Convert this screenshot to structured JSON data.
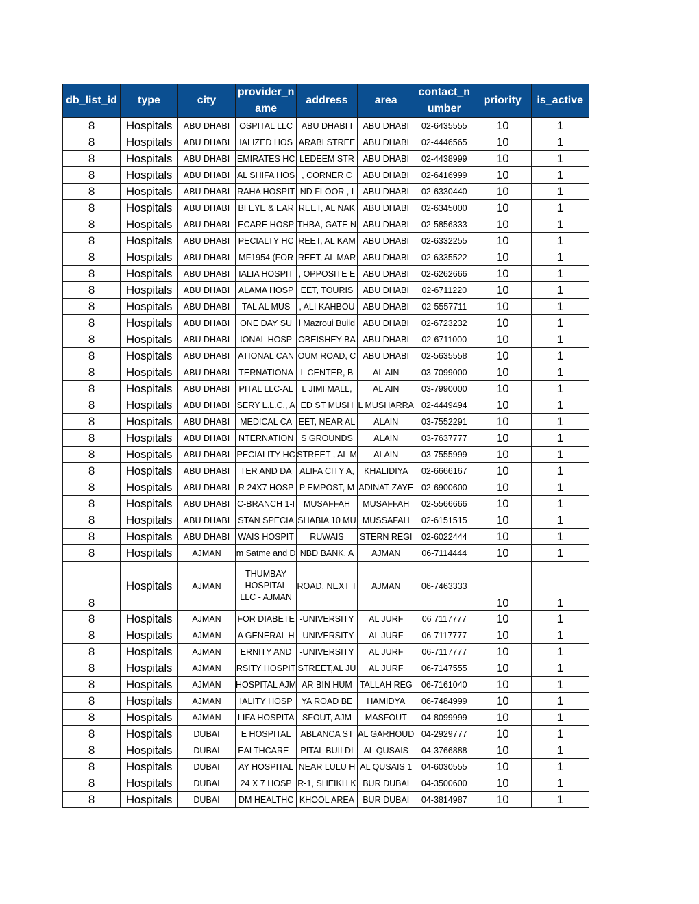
{
  "headers": [
    "db_list_id",
    "type",
    "city",
    "provider_name",
    "address",
    "area",
    "contact_number",
    "priority",
    "is_active"
  ],
  "header_color": "#0b4f91",
  "rows": [
    {
      "db_list_id": "8",
      "type": "Hospitals",
      "city": "ABU DHABI",
      "provider_name": "OSPITAL LLC",
      "address": "ABU DHABI I",
      "area": "ABU DHABI",
      "contact_number": "02-6435555",
      "priority": "10",
      "is_active": "1"
    },
    {
      "db_list_id": "8",
      "type": "Hospitals",
      "city": "ABU DHABI",
      "provider_name": "IALIZED HOS",
      "address": "ARABI STREE",
      "area": "ABU DHABI",
      "contact_number": "02-4446565",
      "priority": "10",
      "is_active": "1"
    },
    {
      "db_list_id": "8",
      "type": "Hospitals",
      "city": "ABU DHABI",
      "provider_name": "EMIRATES HC",
      "address": "LEDEEM STR",
      "area": "ABU DHABI",
      "contact_number": "02-4438999",
      "priority": "10",
      "is_active": "1"
    },
    {
      "db_list_id": "8",
      "type": "Hospitals",
      "city": "ABU DHABI",
      "provider_name": "AL SHIFA HOS",
      "address": ", CORNER C",
      "area": "ABU DHABI",
      "contact_number": "02-6416999",
      "priority": "10",
      "is_active": "1"
    },
    {
      "db_list_id": "8",
      "type": "Hospitals",
      "city": "ABU DHABI",
      "provider_name": "RAHA HOSPIT",
      "address": "ND FLOOR , I",
      "area": "ABU DHABI",
      "contact_number": "02-6330440",
      "priority": "10",
      "is_active": "1"
    },
    {
      "db_list_id": "8",
      "type": "Hospitals",
      "city": "ABU DHABI",
      "provider_name": "BI EYE & EAR",
      "address": "REET, AL NAK",
      "area": "ABU DHABI",
      "contact_number": "02-6345000",
      "priority": "10",
      "is_active": "1"
    },
    {
      "db_list_id": "8",
      "type": "Hospitals",
      "city": "ABU DHABI",
      "provider_name": "ECARE HOSP",
      "address": "THBA, GATE N",
      "area": "ABU DHABI",
      "contact_number": "02-5856333",
      "priority": "10",
      "is_active": "1"
    },
    {
      "db_list_id": "8",
      "type": "Hospitals",
      "city": "ABU DHABI",
      "provider_name": "PECIALTY HC",
      "address": "REET, AL KAM",
      "area": "ABU DHABI",
      "contact_number": "02-6332255",
      "priority": "10",
      "is_active": "1"
    },
    {
      "db_list_id": "8",
      "type": "Hospitals",
      "city": "ABU DHABI",
      "provider_name": "MF1954 (FOR",
      "address": "REET, AL MAR",
      "area": "ABU DHABI",
      "contact_number": "02-6335522",
      "priority": "10",
      "is_active": "1"
    },
    {
      "db_list_id": "8",
      "type": "Hospitals",
      "city": "ABU DHABI",
      "provider_name": "IALIA HOSPIT",
      "address": ", OPPOSITE E",
      "area": "ABU DHABI",
      "contact_number": "02-6262666",
      "priority": "10",
      "is_active": "1"
    },
    {
      "db_list_id": "8",
      "type": "Hospitals",
      "city": "ABU DHABI",
      "provider_name": "ALAMA HOSP",
      "address": "EET, TOURIS",
      "area": "ABU DHABI",
      "contact_number": "02-6711220",
      "priority": "10",
      "is_active": "1"
    },
    {
      "db_list_id": "8",
      "type": "Hospitals",
      "city": "ABU DHABI",
      "provider_name": "TAL AL MUS",
      "address": ", ALI KAHBOU",
      "area": "ABU DHABI",
      "contact_number": "02-5557711",
      "priority": "10",
      "is_active": "1"
    },
    {
      "db_list_id": "8",
      "type": "Hospitals",
      "city": "ABU DHABI",
      "provider_name": "ONE DAY SU",
      "address": "l Mazroui Build",
      "area": "ABU DHABI",
      "contact_number": "02-6723232",
      "priority": "10",
      "is_active": "1"
    },
    {
      "db_list_id": "8",
      "type": "Hospitals",
      "city": "ABU DHABI",
      "provider_name": "IONAL HOSP",
      "address": "OBEISHEY BA",
      "area": "ABU DHABI",
      "contact_number": "02-6711000",
      "priority": "10",
      "is_active": "1"
    },
    {
      "db_list_id": "8",
      "type": "Hospitals",
      "city": "ABU DHABI",
      "provider_name": "ATIONAL CAN",
      "address": "OUM ROAD, C",
      "area": "ABU DHABI",
      "contact_number": "02-5635558",
      "priority": "10",
      "is_active": "1"
    },
    {
      "db_list_id": "8",
      "type": "Hospitals",
      "city": "ABU DHABI",
      "provider_name": "TERNATIONA",
      "address": "L CENTER, B",
      "area": "AL AIN",
      "contact_number": "03-7099000",
      "priority": "10",
      "is_active": "1"
    },
    {
      "db_list_id": "8",
      "type": "Hospitals",
      "city": "ABU DHABI",
      "provider_name": "PITAL LLC-AL",
      "address": "L JIMI MALL,",
      "area": "AL AIN",
      "contact_number": "03-7990000",
      "priority": "10",
      "is_active": "1"
    },
    {
      "db_list_id": "8",
      "type": "Hospitals",
      "city": "ABU DHABI",
      "provider_name": "SERY L.L.C., A",
      "address": "ED ST MUSH",
      "area": "L MUSHARRA",
      "contact_number": "02-4449494",
      "priority": "10",
      "is_active": "1"
    },
    {
      "db_list_id": "8",
      "type": "Hospitals",
      "city": "ABU DHABI",
      "provider_name": "MEDICAL CA",
      "address": "EET, NEAR AL",
      "area": "ALAIN",
      "contact_number": "03-7552291",
      "priority": "10",
      "is_active": "1"
    },
    {
      "db_list_id": "8",
      "type": "Hospitals",
      "city": "ABU DHABI",
      "provider_name": "NTERNATION",
      "address": "S GROUNDS",
      "area": "ALAIN",
      "contact_number": "03-7637777",
      "priority": "10",
      "is_active": "1"
    },
    {
      "db_list_id": "8",
      "type": "Hospitals",
      "city": "ABU DHABI",
      "provider_name": "PECIALITY HC",
      "address": "STREET , AL M",
      "area": "ALAIN",
      "contact_number": "03-7555999",
      "priority": "10",
      "is_active": "1"
    },
    {
      "db_list_id": "8",
      "type": "Hospitals",
      "city": "ABU DHABI",
      "provider_name": "TER AND DA",
      "address": "ALIFA CITY A,",
      "area": "KHALIDIYA",
      "contact_number": "02-6666167",
      "priority": "10",
      "is_active": "1"
    },
    {
      "db_list_id": "8",
      "type": "Hospitals",
      "city": "ABU DHABI",
      "provider_name": "R 24X7 HOSP",
      "address": "P EMPOST, M",
      "area": "ADINAT ZAYE",
      "contact_number": "02-6900600",
      "priority": "10",
      "is_active": "1"
    },
    {
      "db_list_id": "8",
      "type": "Hospitals",
      "city": "ABU DHABI",
      "provider_name": "C-BRANCH 1-I",
      "address": "MUSAFFAH",
      "area": "MUSAFFAH",
      "contact_number": "02-5566666",
      "priority": "10",
      "is_active": "1"
    },
    {
      "db_list_id": "8",
      "type": "Hospitals",
      "city": "ABU DHABI",
      "provider_name": "STAN SPECIA",
      "address": "SHABIA 10 MU",
      "area": "MUSSAFAH",
      "contact_number": "02-6151515",
      "priority": "10",
      "is_active": "1"
    },
    {
      "db_list_id": "8",
      "type": "Hospitals",
      "city": "ABU DHABI",
      "provider_name": "WAIS HOSPIT",
      "address": "RUWAIS",
      "area": "STERN REGI",
      "contact_number": "02-6022444",
      "priority": "10",
      "is_active": "1"
    },
    {
      "db_list_id": "8",
      "type": "Hospitals",
      "city": "AJMAN",
      "provider_name": "m Satme and D",
      "address": "NBD BANK, A",
      "area": "AJMAN",
      "contact_number": "06-7114444",
      "priority": "10",
      "is_active": "1"
    },
    {
      "db_list_id": "8",
      "type": "Hospitals",
      "city": "AJMAN",
      "provider_name": "THUMBAY HOSPITAL LLC - AJMAN",
      "address": "ROAD, NEXT T",
      "area": "AJMAN",
      "contact_number": "06-7463333",
      "priority": "10",
      "is_active": "1",
      "tall": true
    },
    {
      "db_list_id": "8",
      "type": "Hospitals",
      "city": "AJMAN",
      "provider_name": "FOR DIABETE",
      "address": "-UNIVERSITY",
      "area": "AL JURF",
      "contact_number": "06 7117777",
      "priority": "10",
      "is_active": "1"
    },
    {
      "db_list_id": "8",
      "type": "Hospitals",
      "city": "AJMAN",
      "provider_name": "A GENERAL H",
      "address": "-UNIVERSITY",
      "area": "AL JURF",
      "contact_number": "06-7117777",
      "priority": "10",
      "is_active": "1"
    },
    {
      "db_list_id": "8",
      "type": "Hospitals",
      "city": "AJMAN",
      "provider_name": "ERNITY AND",
      "address": "-UNIVERSITY",
      "area": "AL JURF",
      "contact_number": "06-7117777",
      "priority": "10",
      "is_active": "1"
    },
    {
      "db_list_id": "8",
      "type": "Hospitals",
      "city": "AJMAN",
      "provider_name": "RSITY HOSPIT",
      "address": "STREET,AL JU",
      "area": "AL JURF",
      "contact_number": "06-7147555",
      "priority": "10",
      "is_active": "1"
    },
    {
      "db_list_id": "8",
      "type": "Hospitals",
      "city": "AJMAN",
      "provider_name": "HOSPITAL AJM",
      "address": "AR BIN HUM",
      "area": "TALLAH REG",
      "contact_number": "06-7161040",
      "priority": "10",
      "is_active": "1"
    },
    {
      "db_list_id": "8",
      "type": "Hospitals",
      "city": "AJMAN",
      "provider_name": "IALITY HOSP",
      "address": "YA ROAD BE",
      "area": "HAMIDYA",
      "contact_number": "06-7484999",
      "priority": "10",
      "is_active": "1"
    },
    {
      "db_list_id": "8",
      "type": "Hospitals",
      "city": "AJMAN",
      "provider_name": "LIFA HOSPITA",
      "address": "SFOUT, AJM",
      "area": "MASFOUT",
      "contact_number": "04-8099999",
      "priority": "10",
      "is_active": "1"
    },
    {
      "db_list_id": "8",
      "type": "Hospitals",
      "city": "DUBAI",
      "provider_name": "E HOSPITAL",
      "address": "ABLANCA ST",
      "area": "AL GARHOUD",
      "contact_number": "04-2929777",
      "priority": "10",
      "is_active": "1"
    },
    {
      "db_list_id": "8",
      "type": "Hospitals",
      "city": "DUBAI",
      "provider_name": "EALTHCARE -",
      "address": "PITAL BUILDI",
      "area": "AL QUSAIS",
      "contact_number": "04-3766888",
      "priority": "10",
      "is_active": "1"
    },
    {
      "db_list_id": "8",
      "type": "Hospitals",
      "city": "DUBAI",
      "provider_name": "AY HOSPITAL",
      "address": "NEAR LULU H",
      "area": "AL QUSAIS 1",
      "contact_number": "04-6030555",
      "priority": "10",
      "is_active": "1"
    },
    {
      "db_list_id": "8",
      "type": "Hospitals",
      "city": "DUBAI",
      "provider_name": "24 X 7 HOSP",
      "address": "R-1, SHEIKH K",
      "area": "BUR DUBAI",
      "contact_number": "04-3500600",
      "priority": "10",
      "is_active": "1"
    },
    {
      "db_list_id": "8",
      "type": "Hospitals",
      "city": "DUBAI",
      "provider_name": "DM HEALTHC",
      "address": "KHOOL AREA",
      "area": "BUR DUBAI",
      "contact_number": "04-3814987",
      "priority": "10",
      "is_active": "1"
    }
  ]
}
